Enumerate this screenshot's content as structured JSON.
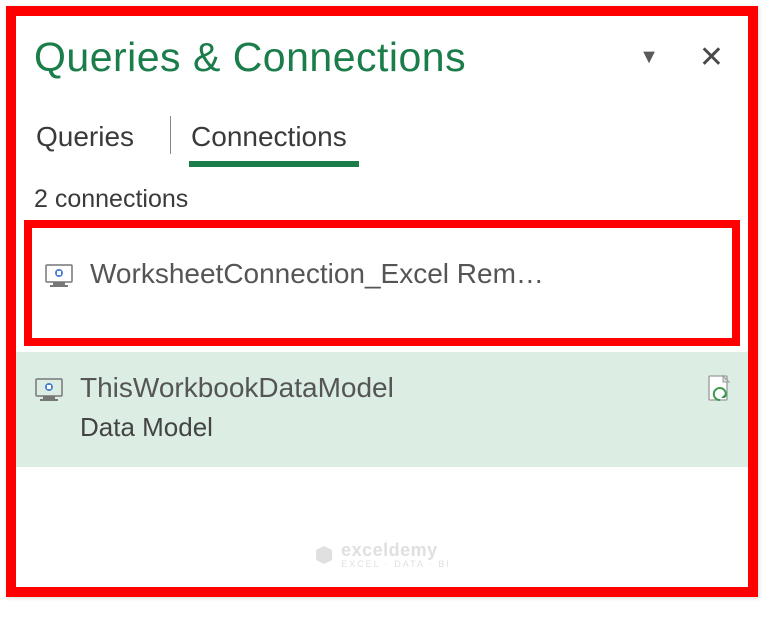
{
  "panel": {
    "title": "Queries & Connections"
  },
  "tabs": {
    "queries": "Queries",
    "connections": "Connections",
    "active": "connections"
  },
  "count_label": "2 connections",
  "connections": [
    {
      "name": "WorksheetConnection_Excel Rem…",
      "subtitle": ""
    },
    {
      "name": "ThisWorkbookDataModel",
      "subtitle": "Data Model"
    }
  ],
  "watermark": {
    "brand": "exceldemy",
    "tagline": "EXCEL · DATA · BI"
  }
}
